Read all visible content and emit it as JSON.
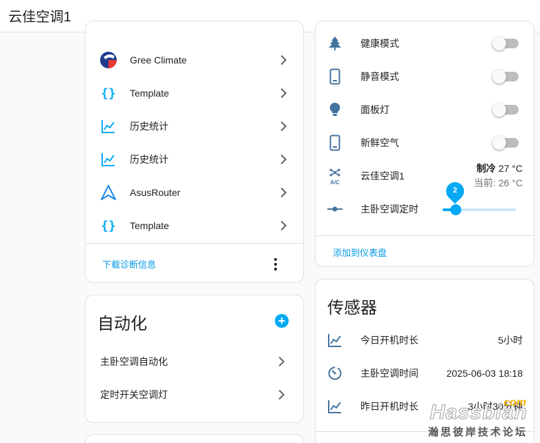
{
  "header": {
    "title": "云佳空调1"
  },
  "integrations": {
    "items": [
      {
        "label": "Gree Climate",
        "icon": "gree-logo-icon"
      },
      {
        "label": "Template",
        "icon": "curly-braces-icon"
      },
      {
        "label": "历史统计",
        "icon": "chart-line-icon"
      },
      {
        "label": "历史统计",
        "icon": "chart-line-icon"
      },
      {
        "label": "AsusRouter",
        "icon": "asus-router-icon"
      },
      {
        "label": "Template",
        "icon": "curly-braces-icon"
      }
    ],
    "download_label": "下载诊断信息"
  },
  "automation": {
    "title": "自动化",
    "items": [
      {
        "label": "主卧空调自动化"
      },
      {
        "label": "定时开关空调灯"
      }
    ]
  },
  "controls": {
    "rows": [
      {
        "label": "健康模式",
        "icon": "pine-tree-icon",
        "on": false
      },
      {
        "label": "静音模式",
        "icon": "phone-icon",
        "on": false
      },
      {
        "label": "面板灯",
        "icon": "lightbulb-icon",
        "on": false
      },
      {
        "label": "新鲜空气",
        "icon": "phone-icon",
        "on": false
      }
    ],
    "climate": {
      "label": "云佳空调1",
      "icon": "air-conditioner-icon",
      "mode": "制冷",
      "target": "27 °C",
      "current": "当前: 26 °C"
    },
    "timer": {
      "label": "主卧空调定时",
      "icon": "ray-vertex-icon",
      "value": "2",
      "level": 0.1
    },
    "add_label": "添加到仪表盘"
  },
  "sensors": {
    "title": "传感器",
    "rows": [
      {
        "label": "今日开机时长",
        "icon": "chart-line-icon",
        "value": "5小时"
      },
      {
        "label": "主卧空调时间",
        "icon": "timer-icon",
        "value": "2025-06-03 18:18"
      },
      {
        "label": "昨日开机时长",
        "icon": "chart-line-icon",
        "value": "3小时30分钟"
      }
    ]
  },
  "watermark": {
    "brand": "Hassbian",
    "com": "com",
    "sub": "瀚思彼岸技术论坛"
  },
  "colors": {
    "accent": "#03a9f4",
    "icon_blue": "#44739e"
  }
}
